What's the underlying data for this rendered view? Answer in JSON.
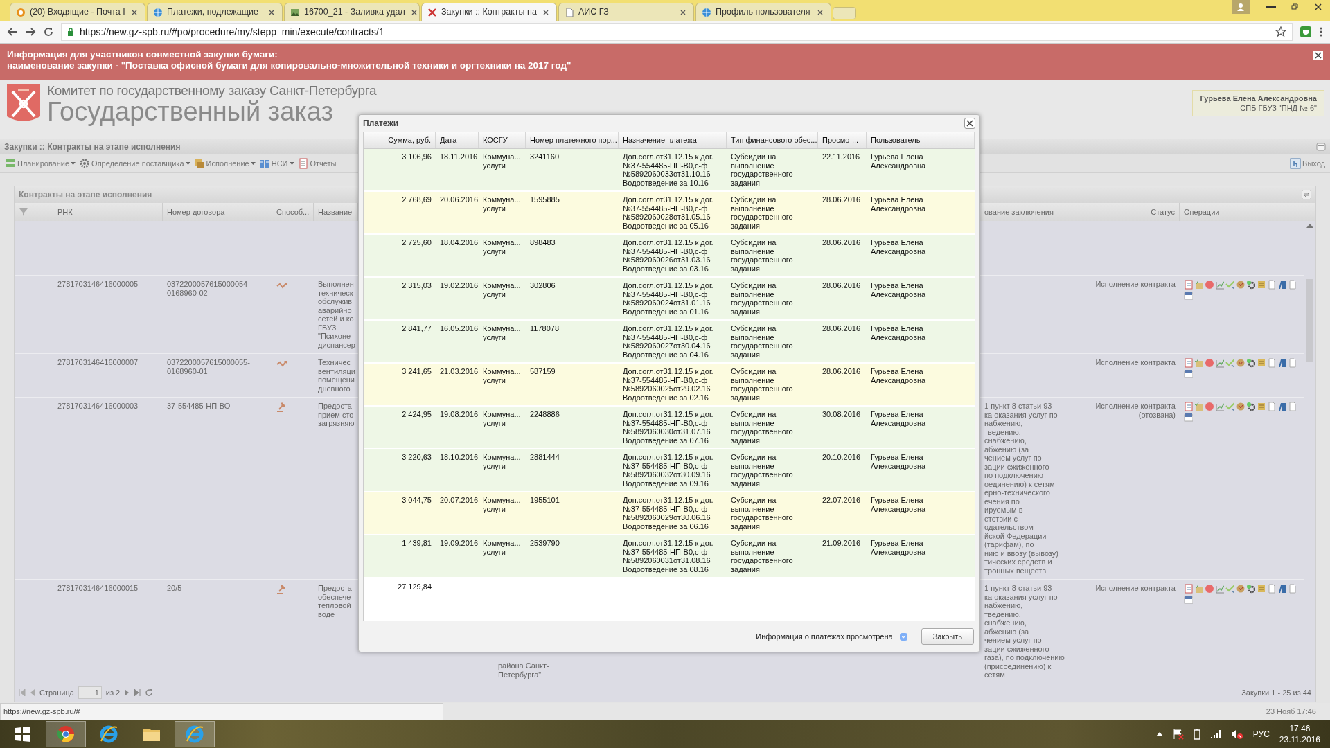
{
  "browser": {
    "tabs": [
      {
        "title": "(20) Входящие - Почта I",
        "kind": "mail",
        "selected": false
      },
      {
        "title": "Платежи, подлежащие",
        "kind": "globe",
        "selected": false
      },
      {
        "title": "16700_21 - Заливка удал",
        "kind": "image",
        "selected": false
      },
      {
        "title": "Закупки :: Контракты на",
        "kind": "logo",
        "selected": true
      },
      {
        "title": "АИС ГЗ",
        "kind": "page",
        "selected": false
      },
      {
        "title": "Профиль пользователя",
        "kind": "globe",
        "selected": false
      }
    ],
    "url": "https://new.gz-spb.ru/#po/procedure/my/stepp_min/execute/contracts/1"
  },
  "banner": {
    "lines": [
      "Информация для участников совместной закупки бумаги:",
      "наименование закупки - \"Поставка офисной бумаги для копировально-множительной техники и оргтехники на 2017 год\""
    ]
  },
  "header": {
    "org": "Комитет по государственному заказу Санкт-Петербурга",
    "title": "Государственный заказ",
    "user": {
      "name": "Гурьева Елена Александровна",
      "org": "СПБ ГБУЗ \"ПНД № 6\""
    }
  },
  "page_title": "Закупки :: Контракты на этапе исполнения",
  "toolbar": {
    "menus": [
      {
        "label": "Планирование",
        "dropdown": true
      },
      {
        "label": "Определение поставщика",
        "dropdown": true
      },
      {
        "label": "Исполнение",
        "dropdown": true
      },
      {
        "label": "НСИ",
        "dropdown": true
      },
      {
        "label": "Отчеты",
        "dropdown": false
      }
    ],
    "exit": "Выход"
  },
  "panel": {
    "title": "Контракты на этапе исполнения",
    "columns": [
      "РНК",
      "Номер договора",
      "Способ...",
      "Название",
      "ование заключения",
      "Статус",
      "Операции"
    ],
    "rows": [
      {
        "rnk": "2781703146416000005",
        "number": "0372200057615000054-0168960-02",
        "kind": "zigzag",
        "name": "Выполнен\nтехническ\nобслужив\nаварийно\nсетей и ко\nГБУЗ\n\"Психоне\nдиспансер",
        "status": "Исполнение контракта"
      },
      {
        "rnk": "2781703146416000007",
        "number": "0372200057615000055-0168960-01",
        "kind": "zigzag",
        "name": "Техничес\nвентиляци\nпомещени\nдневного",
        "status": "Исполнение контракта"
      },
      {
        "rnk": "2781703146416000003",
        "number": "37-554485-НП-ВО",
        "kind": "gavel",
        "name": "Предоста\nприем сто\nзагрязняю",
        "conclusion": "1 пункт 8 статьи 93 -\nка оказания услуг по\nнабжению,\nтведению,\nснабжению,\nабжению (за\nчением услуг по\nзации сжиженного\nпо подключению\nоединению) к сетям\nерно-технического\nечения по\nируемым в\nетствии с\nодательством\nйской Федерации\n(тарифам), по\nнию и ввозу (вывозу)\nтических средств и\nтронных веществ",
        "status": "Исполнение контракта\n(отозвана)"
      },
      {
        "rnk": "2781703146416000015",
        "number": "20/5",
        "kind": "gavel",
        "name": "Предоста\nобеспече\nтепловой\nводе",
        "below_modal": "района Санкт-\nПетербурга\"",
        "conclusion": "1 пункт 8 статьи 93 -\nка оказания услуг по\nнабжению,\nтведению,\nснабжению,\nабжению (за\nчением услуг по\nзации сжиженного\nгаза), по подключению\n(присоединению) к сетям",
        "status": "Исполнение контракта"
      }
    ],
    "pager": {
      "label": "Страница",
      "page": "1",
      "of": "из 2",
      "summary": "Закупки 1 - 25 из 44"
    }
  },
  "modal": {
    "title": "Платежи",
    "columns": [
      "Сумма, руб.",
      "Дата",
      "КОСГУ",
      "Номер платежного пор...",
      "Назначение платежа",
      "Тип финансового обес...",
      "Просмот...",
      "Пользователь"
    ],
    "rows": [
      {
        "amount": "3 106,96",
        "date": "18.11.2016",
        "kosgu": "Коммуна... услуги",
        "doc": "3241160",
        "purpose": "Доп.согл.от31.12.15 к дог.\n№37-554485-НП-В0,с-ф\n№5892060033от31.10.16\nВодоотведение за 10.16",
        "finance": "Субсидии на выполнение государственного задания",
        "viewed": "22.11.2016",
        "user": "Гурьева Елена Александровна",
        "color": "#eef7e6"
      },
      {
        "amount": "2 768,69",
        "date": "20.06.2016",
        "kosgu": "Коммуна... услуги",
        "doc": "1595885",
        "purpose": "Доп.согл.от31.12.15 к дог.\n№37-554485-НП-В0,с-ф\n№5892060028от31.05.16\nВодоотведение за 05.16",
        "finance": "Субсидии на выполнение государственного задания",
        "viewed": "28.06.2016",
        "user": "Гурьева Елена Александровна",
        "color": "#fcfbdf"
      },
      {
        "amount": "2 725,60",
        "date": "18.04.2016",
        "kosgu": "Коммуна... услуги",
        "doc": "898483",
        "purpose": "Доп.согл.от31.12.15 к дог.\n№37-554485-НП-В0,с-ф\n№5892060026от31.03.16\nВодоотведение за 03.16",
        "finance": "Субсидии на выполнение государственного задания",
        "viewed": "28.06.2016",
        "user": "Гурьева Елена Александровна",
        "color": "#eef7e6"
      },
      {
        "amount": "2 315,03",
        "date": "19.02.2016",
        "kosgu": "Коммуна... услуги",
        "doc": "302806",
        "purpose": "Доп.согл.от31.12.15 к дог.\n№37-554485-НП-В0,с-ф\n№5892060024от31.01.16\nВодоотведение за 01.16",
        "finance": "Субсидии на выполнение государственного задания",
        "viewed": "28.06.2016",
        "user": "Гурьева Елена Александровна",
        "color": "#eef7e6"
      },
      {
        "amount": "2 841,77",
        "date": "16.05.2016",
        "kosgu": "Коммуна... услуги",
        "doc": "1178078",
        "purpose": "Доп.согл.от31.12.15 к дог.\n№37-554485-НП-В0,с-ф\n№5892060027от30.04.16\nВодоотведение за 04.16",
        "finance": "Субсидии на выполнение государственного задания",
        "viewed": "28.06.2016",
        "user": "Гурьева Елена Александровна",
        "color": "#eef7e6"
      },
      {
        "amount": "3 241,65",
        "date": "21.03.2016",
        "kosgu": "Коммуна... услуги",
        "doc": "587159",
        "purpose": "Доп.согл.от31.12.15 к дог.\n№37-554485-НП-В0,с-ф\n№5892060025от29.02.16\nВодоотведение за 02.16",
        "finance": "Субсидии на выполнение государственного задания",
        "viewed": "28.06.2016",
        "user": "Гурьева Елена Александровна",
        "color": "#fcfbdf"
      },
      {
        "amount": "2 424,95",
        "date": "19.08.2016",
        "kosgu": "Коммуна... услуги",
        "doc": "2248886",
        "purpose": "Доп.согл.от31.12.15 к дог.\n№37-554485-НП-В0,с-ф\n№5892060030от31.07.16\nВодоотведение за 07.16",
        "finance": "Субсидии на выполнение государственного задания",
        "viewed": "30.08.2016",
        "user": "Гурьева Елена Александровна",
        "color": "#eef7e6"
      },
      {
        "amount": "3 220,63",
        "date": "18.10.2016",
        "kosgu": "Коммуна... услуги",
        "doc": "2881444",
        "purpose": "Доп.согл.от31.12.15 к дог.\n№37-554485-НП-В0,с-ф\n№5892060032от30.09.16\nВодоотведение за 09.16",
        "finance": "Субсидии на выполнение государственного задания",
        "viewed": "20.10.2016",
        "user": "Гурьева Елена Александровна",
        "color": "#eef7e6"
      },
      {
        "amount": "3 044,75",
        "date": "20.07.2016",
        "kosgu": "Коммуна... услуги",
        "doc": "1955101",
        "purpose": "Доп.согл.от31.12.15 к дог.\n№37-554485-НП-В0,с-ф\n№5892060029от30.06.16\nВодоотведение за 06.16",
        "finance": "Субсидии на выполнение государственного задания",
        "viewed": "22.07.2016",
        "user": "Гурьева Елена Александровна",
        "color": "#fcfbdf"
      },
      {
        "amount": "1 439,81",
        "date": "19.09.2016",
        "kosgu": "Коммуна... услуги",
        "doc": "2539790",
        "purpose": "Доп.согл.от31.12.15 к дог.\n№37-554485-НП-В0,с-ф\n№5892060031от31.08.16\nВодоотведение за 08.16",
        "finance": "Субсидии на выполнение государственного задания",
        "viewed": "21.09.2016",
        "user": "Гурьева Елена Александровна",
        "color": "#eef7e6"
      }
    ],
    "total": "27 129,84",
    "footer": {
      "label": "Информация о платежах просмотрена",
      "checked": true,
      "disabled": true,
      "close": "Закрыть"
    }
  },
  "status_bar": {
    "url": "https://new.gz-spb.ru/#",
    "datetime": "23 Нояб 17:46"
  },
  "taskbar": {
    "apps": [
      {
        "kind": "round",
        "running": true
      },
      {
        "kind": "ie",
        "running": false
      },
      {
        "kind": "folder",
        "running": false
      },
      {
        "kind": "ie",
        "running": true
      }
    ],
    "language": "РУС",
    "time": "17:46",
    "date": "23.11.2016"
  }
}
